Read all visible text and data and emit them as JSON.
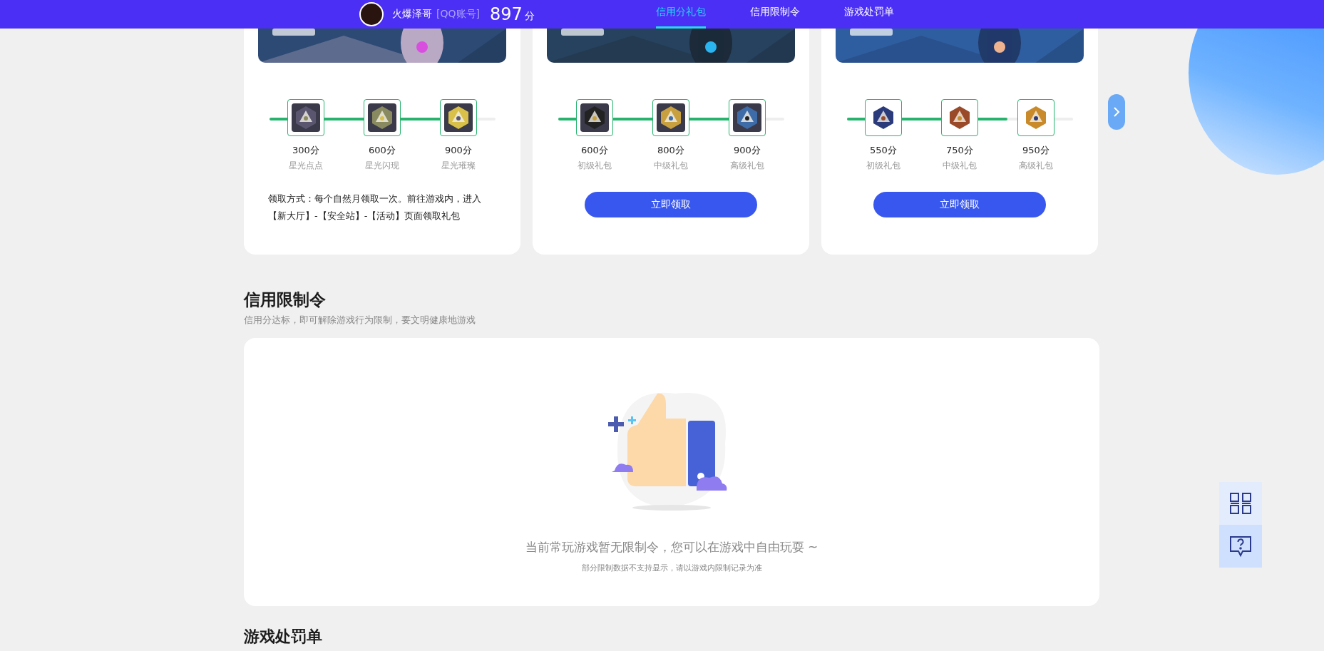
{
  "top_bar": {
    "user": {
      "name": "火爆泽哥",
      "account_tag": "[QQ账号]",
      "score": "897",
      "unit": "分"
    },
    "tabs": [
      {
        "label": "信用分礼包",
        "selected": true
      },
      {
        "label": "信用限制令",
        "selected": false
      },
      {
        "label": "游戏处罚单",
        "selected": false
      }
    ]
  },
  "gift_cards": [
    {
      "level": 0.88,
      "rewards": [
        {
          "points": "300分",
          "name": "星光点点"
        },
        {
          "points": "600分",
          "name": "星光闪现"
        },
        {
          "points": "900分",
          "name": "星光璀璨"
        }
      ],
      "footer": {
        "kind": "text",
        "text": "领取方式：每个自然月领取一次。前往游戏内，进入【新大厅】-【安全站】-【活动】页面领取礼包"
      }
    },
    {
      "level": 0.88,
      "rewards": [
        {
          "points": "600分",
          "name": "初级礼包"
        },
        {
          "points": "800分",
          "name": "中级礼包"
        },
        {
          "points": "900分",
          "name": "高级礼包"
        }
      ],
      "footer": {
        "kind": "button",
        "text": "立即领取"
      }
    },
    {
      "level": 0.71,
      "rewards": [
        {
          "points": "550分",
          "name": "初级礼包"
        },
        {
          "points": "750分",
          "name": "中级礼包"
        },
        {
          "points": "950分",
          "name": "高级礼包"
        }
      ],
      "footer": {
        "kind": "button",
        "text": "立即领取"
      }
    }
  ],
  "restriction_section": {
    "title": "信用限制令",
    "subtitle": "信用分达标，即可解除游戏行为限制，要文明健康地游戏",
    "empty_message": "当前常玩游戏暂无限制令，您可以在游戏中自由玩耍 ~",
    "note": "部分限制数据不支持显示，请以游戏内限制记录为准"
  },
  "penalty_section": {
    "title": "游戏处罚单"
  }
}
